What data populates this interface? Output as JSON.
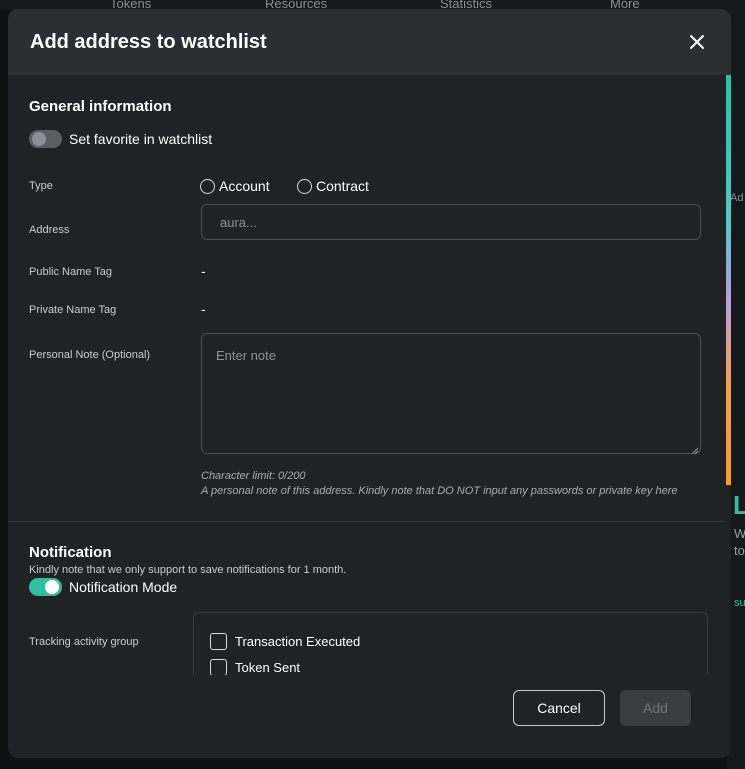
{
  "background": {
    "nav_items": [
      "Tokens",
      "Resources",
      "Statistics",
      "More"
    ],
    "side_ad": "Ad",
    "side_l": "L",
    "side_w": "W",
    "side_t": "to",
    "side_s": "su"
  },
  "modal": {
    "title": "Add address to watchlist",
    "general": {
      "title": "General information",
      "favorite_label": "Set favorite in watchlist",
      "favorite_on": false,
      "type_label": "Type",
      "type_options": [
        "Account",
        "Contract"
      ],
      "address_label": "Address",
      "address_placeholder": "aura...",
      "public_name_label": "Public Name Tag",
      "public_name_value": "-",
      "private_name_label": "Private Name Tag",
      "private_name_value": "-",
      "note_label": "Personal Note (Optional)",
      "note_placeholder": "Enter note",
      "char_limit": "Character limit: 0/200",
      "note_hint": "A personal note of this address. Kindly note that DO NOT input any passwords or private key here"
    },
    "notification": {
      "title": "Notification",
      "description": "Kindly note that we only support to save notifications for 1 month.",
      "mode_label": "Notification Mode",
      "mode_on": true,
      "tracking_label": "Tracking activity group",
      "tracking_options": [
        "Transaction Executed",
        "Token Sent"
      ]
    },
    "footer": {
      "cancel_label": "Cancel",
      "add_label": "Add"
    }
  },
  "colors": {
    "accent": "#2fbfa0",
    "modal_bg": "#212226",
    "header_bg": "#2c2e33"
  }
}
